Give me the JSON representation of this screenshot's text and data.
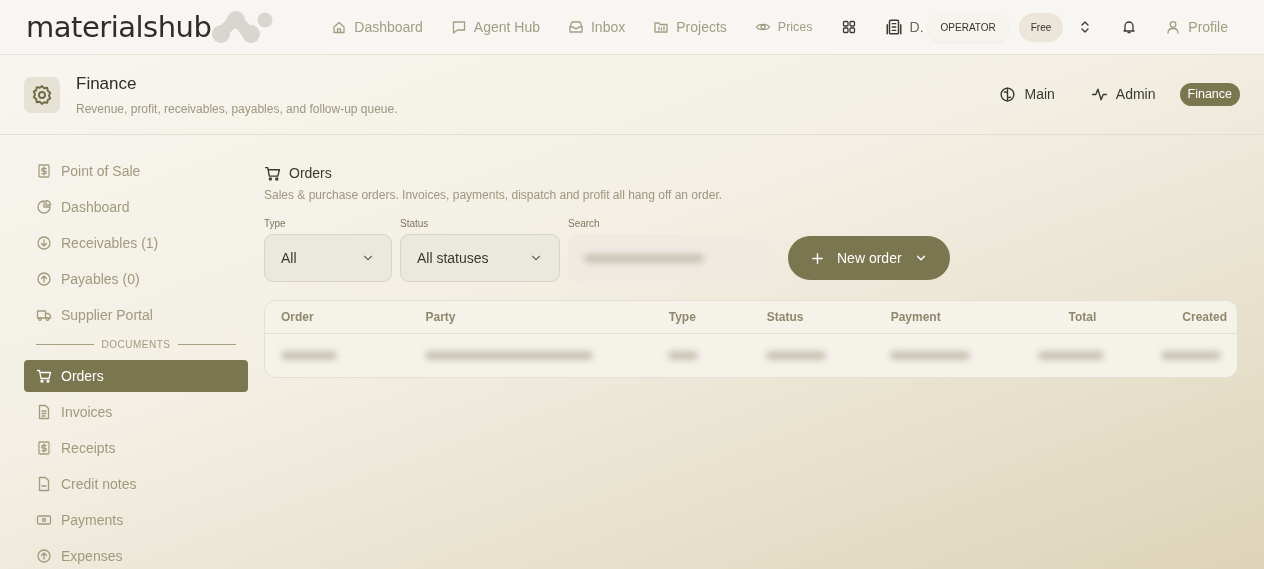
{
  "brand": {
    "name": "materialshub"
  },
  "topnav": [
    {
      "kind": "link",
      "label": "Dashboard"
    },
    {
      "kind": "link",
      "label": "Agent Hub"
    },
    {
      "kind": "link",
      "label": "Inbox"
    },
    {
      "kind": "link",
      "label": "Projects"
    },
    {
      "kind": "small",
      "label": "Prices"
    },
    {
      "kind": "icon"
    },
    {
      "kind": "org",
      "label": "D."
    },
    {
      "kind": "pill",
      "label": "OPERATOR"
    },
    {
      "kind": "plan",
      "label": "Free"
    },
    {
      "kind": "icon"
    },
    {
      "kind": "icon"
    },
    {
      "kind": "link",
      "label": "Profile"
    }
  ],
  "header": {
    "title": "Finance",
    "subtitle": "Revenue, profit, receivables, payables, and follow-up queue.",
    "switcher": [
      {
        "label": "Main",
        "selected": false
      },
      {
        "label": "Admin",
        "selected": false
      },
      {
        "label": "Finance",
        "selected": true
      }
    ]
  },
  "sidebar": {
    "items": [
      {
        "label": "Point of Sale",
        "selected": false
      },
      {
        "label": "Dashboard",
        "selected": false
      },
      {
        "label": "Receivables (1)",
        "selected": false
      },
      {
        "label": "Payables (0)",
        "selected": false
      },
      {
        "label": "Supplier Portal",
        "selected": false
      }
    ],
    "section": "DOCUMENTS",
    "documents": [
      {
        "label": "Orders",
        "selected": true
      },
      {
        "label": "Invoices",
        "selected": false
      },
      {
        "label": "Receipts",
        "selected": false
      },
      {
        "label": "Credit notes",
        "selected": false
      },
      {
        "label": "Payments",
        "selected": false
      },
      {
        "label": "Expenses",
        "selected": false
      }
    ]
  },
  "orders": {
    "title": "Orders",
    "description": "Sales & purchase orders. Invoices, payments, dispatch and profit all hang off an order.",
    "filters": [
      {
        "label": "Type",
        "value": "All"
      },
      {
        "label": "Status",
        "value": "All statuses"
      }
    ],
    "search": {
      "label": "Search",
      "blurred": true
    },
    "new_button": "New order",
    "table": {
      "columns": [
        "Order",
        "Party",
        "Type",
        "Status",
        "Payment",
        "Total",
        "Created"
      ],
      "rows": [
        {
          "kind": "redacted"
        }
      ]
    }
  }
}
